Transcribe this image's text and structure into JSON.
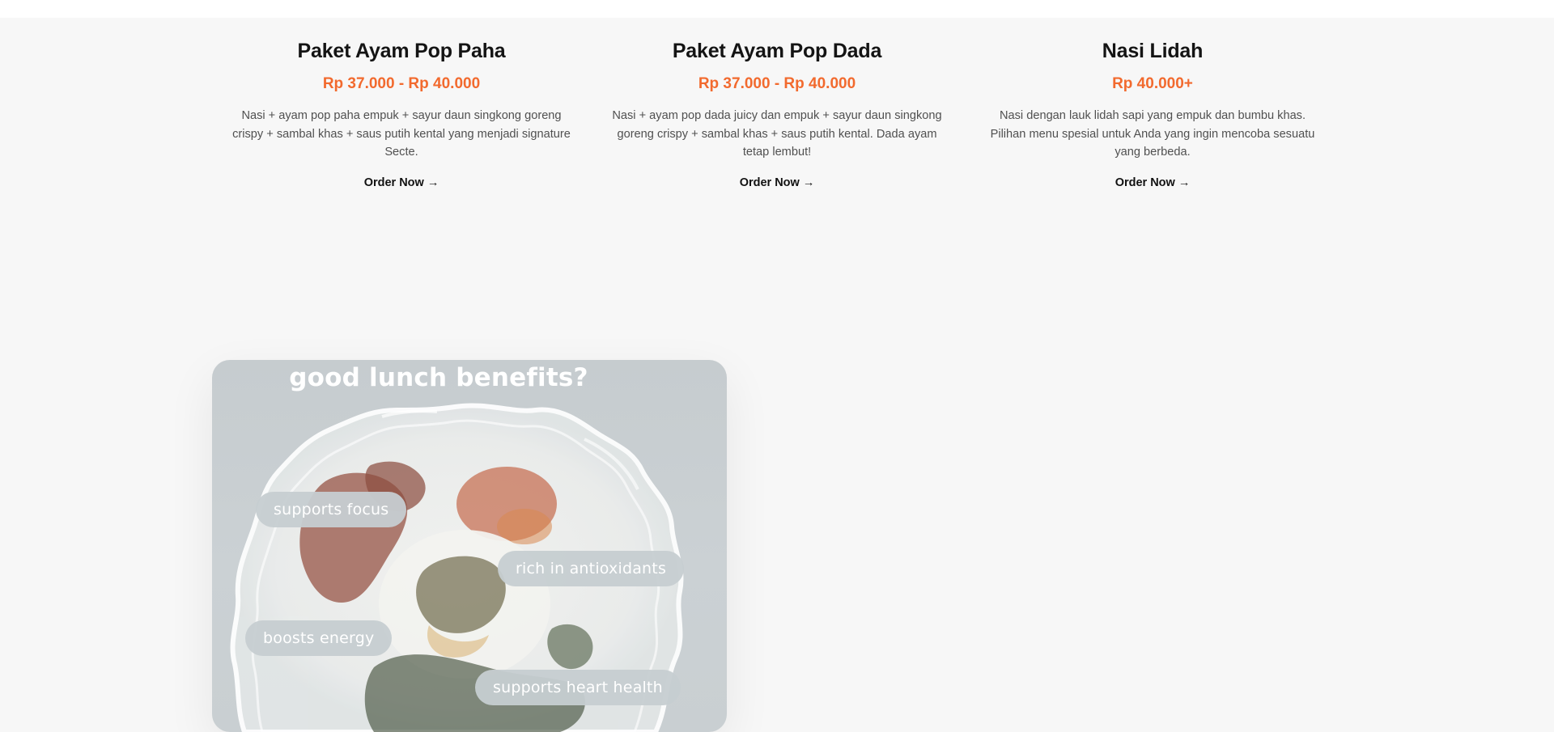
{
  "menu": {
    "items": [
      {
        "title": "Paket Ayam Pop Paha",
        "price": "Rp 37.000 - Rp 40.000",
        "description": "Nasi + ayam pop paha empuk + sayur daun singkong goreng crispy + sambal khas + saus putih kental yang menjadi signature Secte.",
        "order_label": "Order Now",
        "order_icon": "arrow-right-icon"
      },
      {
        "title": "Paket Ayam Pop Dada",
        "price": "Rp 37.000 - Rp 40.000",
        "description": "Nasi + ayam pop dada juicy dan empuk + sayur daun singkong goreng crispy + sambal khas + saus putih kental. Dada ayam tetap lembut!",
        "order_label": "Order Now",
        "order_icon": "arrow-right-icon"
      },
      {
        "title": "Nasi Lidah",
        "price": "Rp 40.000+",
        "description": "Nasi dengan lauk lidah sapi yang empuk dan bumbu khas. Pilihan menu spesial untuk Anda yang ingin mencoba sesuatu yang berbeda.",
        "order_label": "Order Now",
        "order_icon": "arrow-right-icon"
      }
    ]
  },
  "promo": {
    "title": "good lunch benefits?",
    "benefits": [
      "supports focus",
      "rich in antioxidants",
      "boosts energy",
      "supports heart health"
    ]
  },
  "colors": {
    "accent_price": "#f26a2e",
    "background": "#f7f7f7",
    "promo_background": "#c8cfd2"
  }
}
